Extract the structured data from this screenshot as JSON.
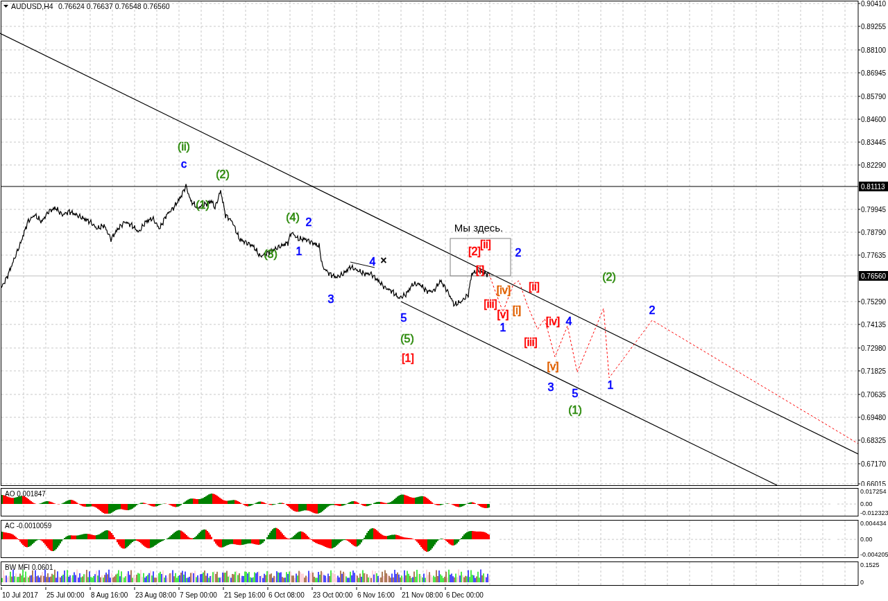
{
  "header": {
    "symbol": "AUDUSD,H4",
    "quotes": "0.76624 0.76637 0.76548 0.76560"
  },
  "price_axis": {
    "labels": [
      "0.90410",
      "0.89255",
      "0.88100",
      "0.86945",
      "0.85790",
      "0.84600",
      "0.83445",
      "0.82290",
      "0.79945",
      "0.78790",
      "0.77635",
      "0.75290",
      "0.74135",
      "0.72980",
      "0.71825",
      "0.70635",
      "0.69480",
      "0.68325",
      "0.67170",
      "0.66015"
    ],
    "tags": [
      {
        "label": "0.81113",
        "kind": "level"
      },
      {
        "label": "0.76560",
        "kind": "current"
      }
    ]
  },
  "note": "Мы здесь.",
  "wave_labels": [
    {
      "text": "(ii)",
      "color": "#2e8b0e"
    },
    {
      "text": "c",
      "color": "#0000ff"
    },
    {
      "text": "(1)",
      "color": "#2e8b0e"
    },
    {
      "text": "(2)",
      "color": "#2e8b0e"
    },
    {
      "text": "(3)",
      "color": "#2e8b0e"
    },
    {
      "text": "(4)",
      "color": "#2e8b0e"
    },
    {
      "text": "1",
      "color": "#0000ff"
    },
    {
      "text": "2",
      "color": "#0000ff"
    },
    {
      "text": "3",
      "color": "#0000ff"
    },
    {
      "text": "4",
      "color": "#0000ff"
    },
    {
      "text": "×",
      "color": "#000000"
    },
    {
      "text": "5",
      "color": "#0000ff"
    },
    {
      "text": "(5)",
      "color": "#2e8b0e"
    },
    {
      "text": "[1]",
      "color": "#ff0000"
    },
    {
      "text": "[2]",
      "color": "#ff0000"
    },
    {
      "text": "[i]",
      "color": "#ff0000"
    },
    {
      "text": "[ii]",
      "color": "#ff0000"
    },
    {
      "text": "[iii]",
      "color": "#ff0000"
    },
    {
      "text": "[iv]",
      "color": "#e06000"
    },
    {
      "text": "[v]",
      "color": "#ff0000"
    },
    {
      "text": "1",
      "color": "#0000ff"
    },
    {
      "text": "[i]",
      "color": "#e06000"
    },
    {
      "text": "2",
      "color": "#0000ff"
    },
    {
      "text": "[iii]",
      "color": "#ff0000"
    },
    {
      "text": "[ii]",
      "color": "#ff0000"
    },
    {
      "text": "[iv]",
      "color": "#ff0000"
    },
    {
      "text": "[v]",
      "color": "#e06000"
    },
    {
      "text": "3",
      "color": "#0000ff"
    },
    {
      "text": "4",
      "color": "#0000ff"
    },
    {
      "text": "5",
      "color": "#0000ff"
    },
    {
      "text": "(1)",
      "color": "#2e8b0e"
    },
    {
      "text": "(2)",
      "color": "#2e8b0e"
    },
    {
      "text": "1",
      "color": "#0000ff"
    },
    {
      "text": "2",
      "color": "#0000ff"
    }
  ],
  "time_axis": [
    "10 Jul 2017",
    "25 Jul 00:00",
    "8 Aug 16:00",
    "23 Aug 08:00",
    "7 Sep 00:00",
    "21 Sep 16:00",
    "6 Oct 08:00",
    "23 Oct 00:00",
    "6 Nov 16:00",
    "21 Nov 08:00",
    "6 Dec 00:00"
  ],
  "indicators": [
    {
      "label": "AO 0.001847",
      "kind": "oscillator",
      "ticks": [
        "0.017254",
        "0.00",
        "-0.012323"
      ]
    },
    {
      "label": "AC -0.0010059",
      "kind": "oscillator",
      "ticks": [
        "0.004434",
        "0.00",
        "-0.004205"
      ]
    },
    {
      "label": "BW MFI 0.0601",
      "kind": "mfi",
      "ticks": [
        "0.1525",
        "0"
      ]
    }
  ]
}
